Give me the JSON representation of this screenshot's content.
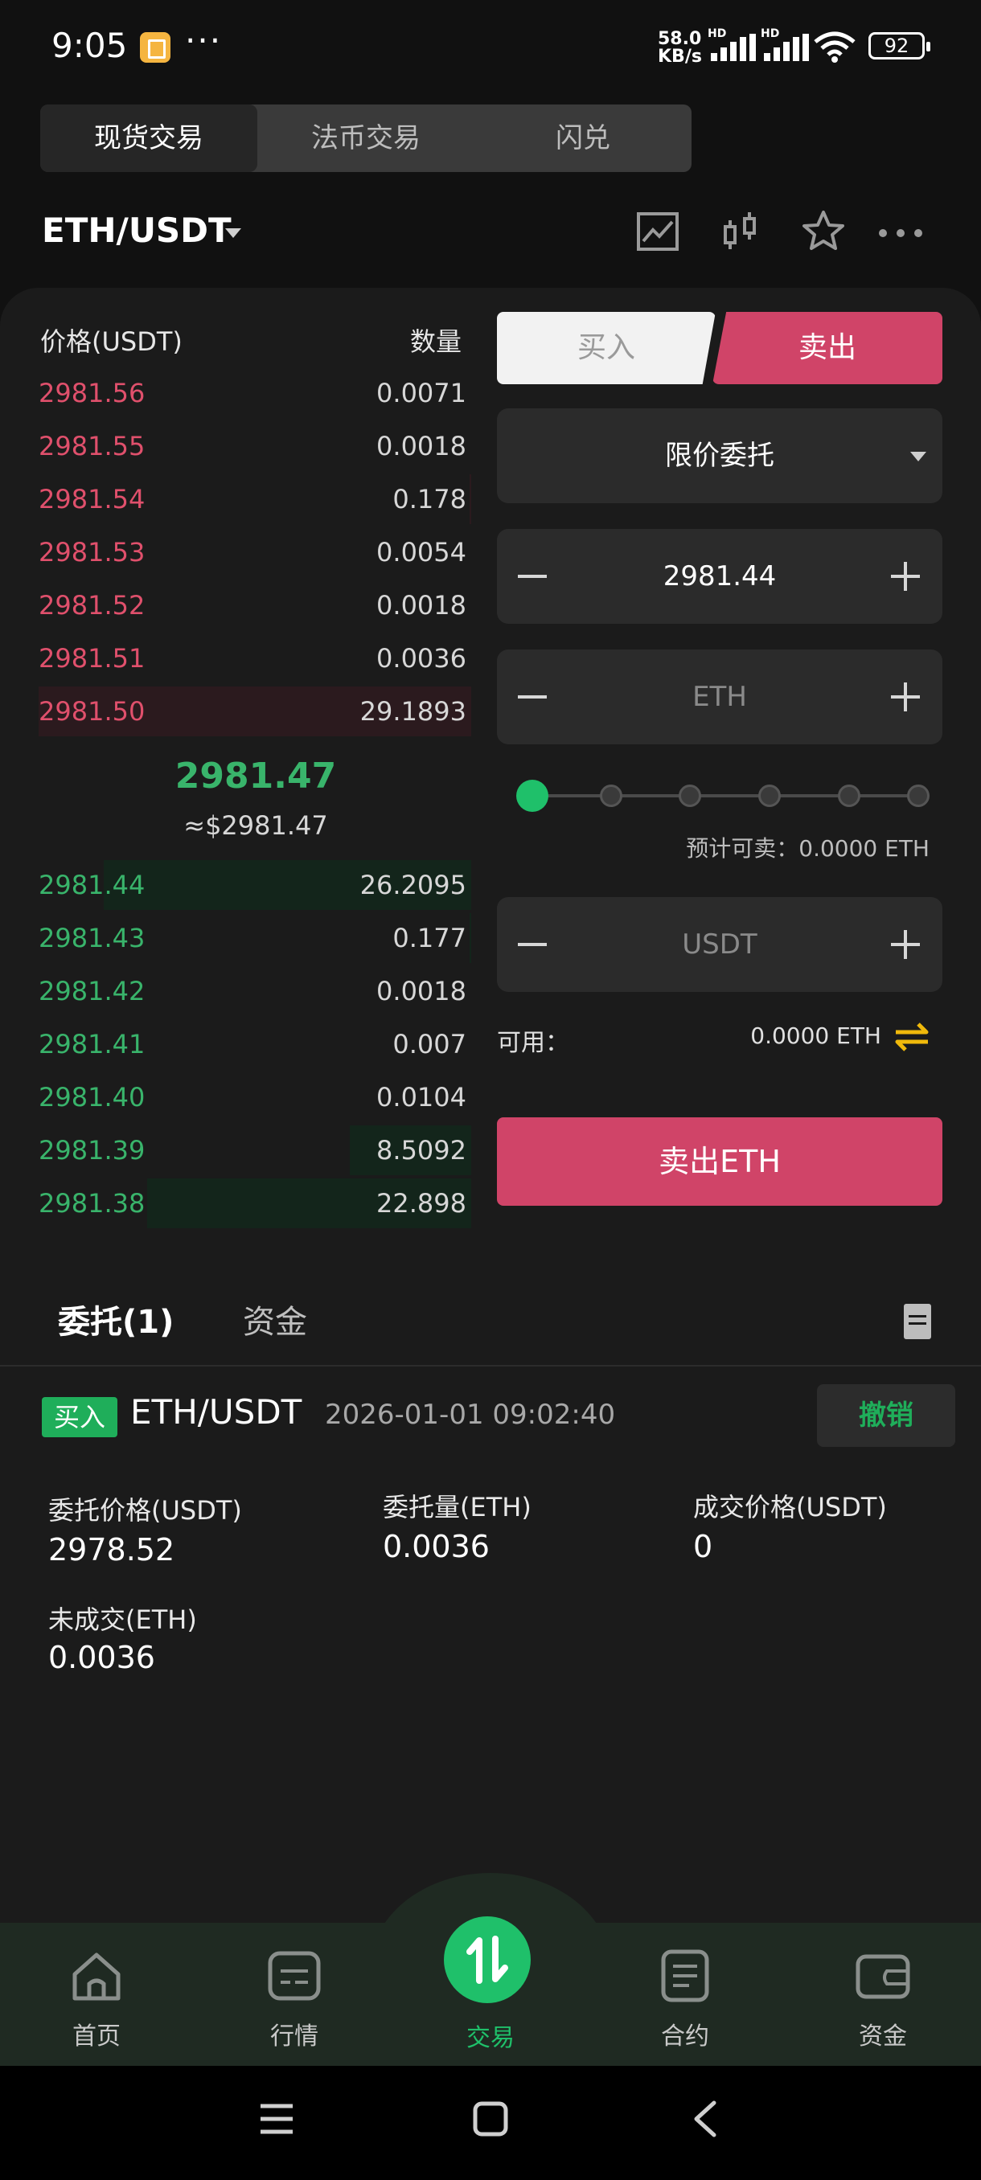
{
  "status_bar": {
    "time": "9:05",
    "more": "···",
    "speed_value": "58.0",
    "speed_unit": "KB/s",
    "hd1": "HD",
    "hd2": "HD",
    "battery": "92"
  },
  "top_tabs": [
    "现货交易",
    "法币交易",
    "闪兑"
  ],
  "header": {
    "pair": "ETH/USDT"
  },
  "order_book": {
    "price_header": "价格(USDT)",
    "qty_header": "数量",
    "asks": [
      {
        "price": "2981.56",
        "qty": "0.0071",
        "depth": 0.0
      },
      {
        "price": "2981.55",
        "qty": "0.0018",
        "depth": 0.0
      },
      {
        "price": "2981.54",
        "qty": "0.178",
        "depth": 0.004
      },
      {
        "price": "2981.53",
        "qty": "0.0054",
        "depth": 0.0
      },
      {
        "price": "2981.52",
        "qty": "0.0018",
        "depth": 0.0
      },
      {
        "price": "2981.51",
        "qty": "0.0036",
        "depth": 0.0
      },
      {
        "price": "2981.50",
        "qty": "29.1893",
        "depth": 1.0
      }
    ],
    "mid_price": "2981.47",
    "mid_usd": "≈$2981.47",
    "bids": [
      {
        "price": "2981.44",
        "qty": "26.2095",
        "depth": 0.85
      },
      {
        "price": "2981.43",
        "qty": "0.177",
        "depth": 0.004
      },
      {
        "price": "2981.42",
        "qty": "0.0018",
        "depth": 0.0
      },
      {
        "price": "2981.41",
        "qty": "0.007",
        "depth": 0.0
      },
      {
        "price": "2981.40",
        "qty": "0.0104",
        "depth": 0.0
      },
      {
        "price": "2981.39",
        "qty": "8.5092",
        "depth": 0.28
      },
      {
        "price": "2981.38",
        "qty": "22.898",
        "depth": 0.75
      }
    ]
  },
  "trade_form": {
    "buy_label": "买入",
    "sell_label": "卖出",
    "order_type": "限价委托",
    "price_value": "2981.44",
    "amount_placeholder": "ETH",
    "total_placeholder": "USDT",
    "est_sellable": "预计可卖：0.0000  ETH",
    "available_label": "可用：",
    "available_value": "0.0000  ETH",
    "submit_label": "卖出ETH",
    "slider_level": 0
  },
  "orders": {
    "tab_orders": "委托(1)",
    "tab_funds": "资金",
    "item": {
      "side": "买入",
      "pair": "ETH/USDT",
      "time": "2026-01-01 09:02:40",
      "cancel": "撤销",
      "price_label": "委托价格(USDT)",
      "price_value": "2978.52",
      "amount_label": "委托量(ETH)",
      "amount_value": "0.0036",
      "deal_label": "成交价格(USDT)",
      "deal_value": "0",
      "unfilled_label": "未成交(ETH)",
      "unfilled_value": "0.0036"
    }
  },
  "bottom_nav": [
    "首页",
    "行情",
    "交易",
    "合约",
    "资金"
  ],
  "colors": {
    "accent_green": "#1fc06a",
    "sell_red": "#d04468",
    "ask_red": "#e0506c",
    "bid_green": "#39b46b"
  }
}
